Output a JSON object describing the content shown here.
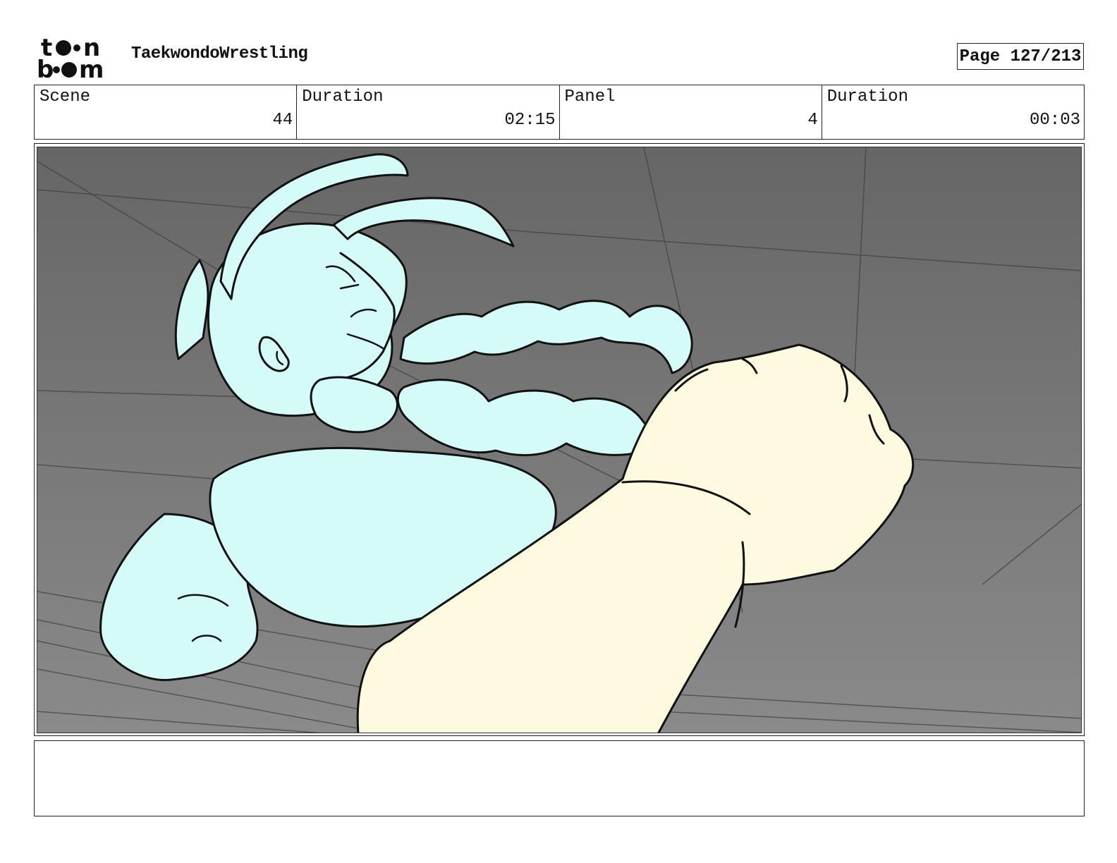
{
  "header": {
    "logo_text_top": "toon",
    "logo_text_bottom": "boom",
    "project_title": "TaekwondoWrestling",
    "page_label": "Page 127/213"
  },
  "info": {
    "scene_label": "Scene",
    "scene_value": "44",
    "scene_duration_label": "Duration",
    "scene_duration_value": "02:15",
    "panel_label": "Panel",
    "panel_value": "4",
    "panel_duration_label": "Duration",
    "panel_duration_value": "00:03"
  },
  "colors": {
    "background_gray": "#6b6b6b",
    "character_fill": "#d4fbf7",
    "fist_fill": "#fefae0",
    "ink": "#111111"
  },
  "notes": {
    "text": ""
  }
}
